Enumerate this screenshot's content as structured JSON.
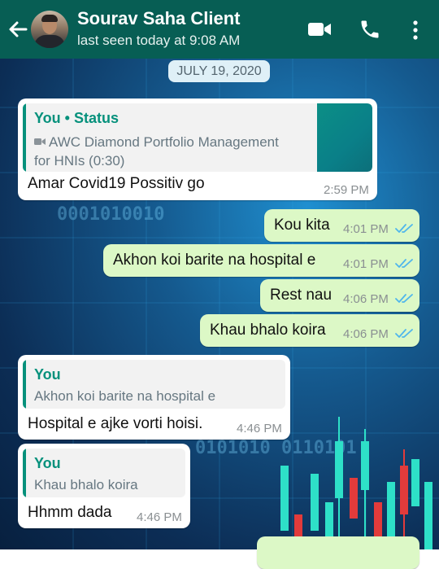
{
  "header": {
    "contact_name": "Sourav Saha Client",
    "last_seen": "last seen today at 9:08 AM",
    "icons": [
      "back-arrow-icon",
      "avatar",
      "video-call-icon",
      "phone-icon",
      "more-options-icon"
    ]
  },
  "date_label": "JULY 19, 2020",
  "messages": [
    {
      "direction": "incoming",
      "quote_author": "You • Status",
      "quote_line1": "AWC Diamond Portfolio Management",
      "quote_line2": "for  HNIs (0:30)",
      "quote_icon": "video-icon",
      "text": "Amar Covid19 Possitiv go",
      "time": "2:59 PM"
    },
    {
      "direction": "outgoing",
      "text": "Kou kita",
      "time": "4:01 PM",
      "status": "read"
    },
    {
      "direction": "outgoing",
      "text": "Akhon koi barite na hospital e",
      "time": "4:01 PM",
      "status": "read"
    },
    {
      "direction": "outgoing",
      "text": "Rest nau",
      "time": "4:06 PM",
      "status": "read"
    },
    {
      "direction": "outgoing",
      "text": "Khau bhalo koira",
      "time": "4:06 PM",
      "status": "read"
    },
    {
      "direction": "incoming",
      "quote_author": "You",
      "quote_text": "Akhon koi barite na hospital e",
      "text": "Hospital e ajke vorti hoisi.",
      "time": "4:46 PM"
    },
    {
      "direction": "incoming",
      "quote_author": "You",
      "quote_text": "Khau bhalo koira",
      "text": "Hhmm dada",
      "time": "4:46 PM"
    }
  ],
  "colors": {
    "header": "#075e54",
    "outgoing_bubble": "#dcf8c6",
    "incoming_bubble": "#ffffff",
    "read_ticks": "#4fb6ec",
    "quote_accent": "#06917c"
  }
}
